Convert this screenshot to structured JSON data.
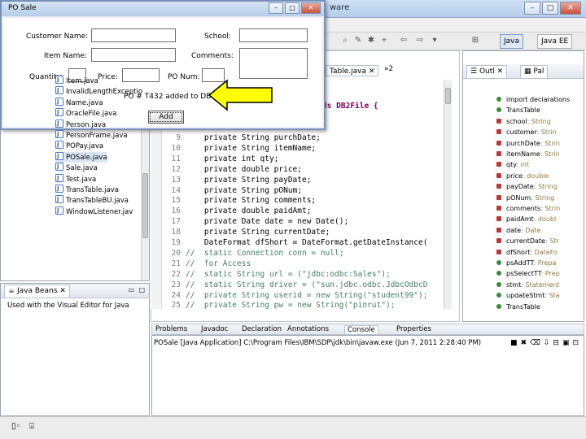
{
  "window": {
    "app_title": "ware",
    "caption": {
      "minimize": "–",
      "maximize": "□",
      "close": "✕"
    }
  },
  "toolbar": {
    "perspective_java": "Java",
    "perspective_java_ee": "Java EE"
  },
  "package_explorer": {
    "items": [
      {
        "label": "Item.java"
      },
      {
        "label": "InvalidLengthExceptio"
      },
      {
        "label": "Name.java"
      },
      {
        "label": "OracleFile.java"
      },
      {
        "label": "Person.java"
      },
      {
        "label": "PersonFrame.java"
      },
      {
        "label": "POPay.java"
      },
      {
        "label": "POSale.java",
        "selected": true
      },
      {
        "label": "Sale.java"
      },
      {
        "label": "Test.java"
      },
      {
        "label": "TransTable.java"
      },
      {
        "label": "TransTableBU.java"
      },
      {
        "label": "WindowListener.jav"
      }
    ]
  },
  "java_beans": {
    "tab_label": "Java Beans",
    "description": "Used with the Visual Editor for Java"
  },
  "editor": {
    "tab_label": "Table.java",
    "overflow_tab": "»2",
    "partial_line": "ds DB2File {",
    "lines": [
      {
        "num": "9",
        "code": "    private String purchDate;"
      },
      {
        "num": "10",
        "code": "    private String itemName;"
      },
      {
        "num": "11",
        "code": "    private int qty;"
      },
      {
        "num": "12",
        "code": "    private double price;"
      },
      {
        "num": "13",
        "code": "    private String payDate;"
      },
      {
        "num": "14",
        "code": "    private String pONum;"
      },
      {
        "num": "15",
        "code": "    private String comments;"
      },
      {
        "num": "16",
        "code": "    private double paidAmt;"
      },
      {
        "num": "17",
        "code": "    private Date date = new Date();"
      },
      {
        "num": "18",
        "code": "    private String currentDate;"
      },
      {
        "num": "19",
        "code": "    DateFormat dfShort = DateFormat.getDateInstance("
      },
      {
        "num": "20",
        "code": "//  static Connection conn = null;"
      },
      {
        "num": "21",
        "code": "//  for Access"
      },
      {
        "num": "22",
        "code": "//  static String url = (\"jdbc:odbc:Sales\");"
      },
      {
        "num": "23",
        "code": "//  static String driver = (\"sun.jdbc.odbc.JdbcOdbcD"
      },
      {
        "num": "24",
        "code": "//  private String userid = new String(\"student99\");"
      },
      {
        "num": "25",
        "code": "//  private String pw = new String(\"pinrut\");"
      }
    ]
  },
  "outline": {
    "tab_outline": "Outl",
    "tab_palette": "Pal",
    "items": [
      {
        "label": "import declarations",
        "kind": "import"
      },
      {
        "label": "TransTable",
        "kind": "class"
      },
      {
        "label": "school",
        "type": ": String",
        "kind": "priv"
      },
      {
        "label": "customer",
        "type": ": Strin",
        "kind": "priv"
      },
      {
        "label": "purchDate",
        "type": ": Strin",
        "kind": "priv"
      },
      {
        "label": "itemName",
        "type": ": Strin",
        "kind": "priv"
      },
      {
        "label": "qty",
        "type": ": int",
        "kind": "priv"
      },
      {
        "label": "price",
        "type": ": double",
        "kind": "priv"
      },
      {
        "label": "payDate",
        "type": ": String",
        "kind": "priv"
      },
      {
        "label": "pONum",
        "type": ": String",
        "kind": "priv"
      },
      {
        "label": "comments",
        "type": ": Strin",
        "kind": "priv"
      },
      {
        "label": "paidAmt",
        "type": ": doubl",
        "kind": "priv"
      },
      {
        "label": "date",
        "type": ": Date",
        "kind": "priv"
      },
      {
        "label": "currentDate",
        "type": ": Str",
        "kind": "priv"
      },
      {
        "label": "dfShort",
        "type": ": DateFo",
        "kind": "priv"
      },
      {
        "label": "psAddTT",
        "type": ": Prepa",
        "kind": "pub"
      },
      {
        "label": "psSelectTT",
        "type": ": Prep",
        "kind": "pub"
      },
      {
        "label": "stmt",
        "type": ": Statement",
        "kind": "pub"
      },
      {
        "label": "updateStmt",
        "type": ": Sta",
        "kind": "pub"
      },
      {
        "label": "TransTable",
        "type": "",
        "kind": "pub"
      }
    ]
  },
  "bottom_tabs": [
    "Problems",
    "Javadoc",
    "Declaration",
    "Annotations",
    "Console",
    "Properties"
  ],
  "console": {
    "description": "POSale [Java Application] C:\\Program Files\\IBM\\SDP\\jdk\\bin\\javaw.exe (Jun 7, 2011 2:28:40 PM)"
  },
  "dialog": {
    "title": "PO Sale",
    "fields": {
      "customer_name_label": "Customer Name:",
      "school_label": "School:",
      "item_name_label": "Item Name:",
      "comments_label": "Comments:",
      "quantity_label": "Quantity:",
      "price_label": "Price:",
      "po_num_label": "PO Num:"
    },
    "message": "PO # T432 added to DB",
    "add_button": "Add"
  }
}
